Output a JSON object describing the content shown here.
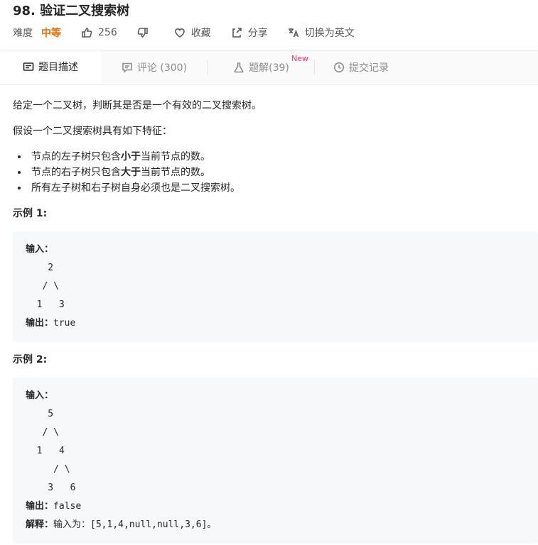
{
  "header": {
    "title": "98. 验证二叉搜索树",
    "difficulty_label": "难度",
    "difficulty": "中等",
    "likes": "256",
    "favorite_label": "收藏",
    "share_label": "分享",
    "lang_label": "切换为英文"
  },
  "tabs": [
    {
      "label": "题目描述"
    },
    {
      "label": "评论 (300)"
    },
    {
      "label": "题解(39)",
      "badge": "New"
    },
    {
      "label": "提交记录"
    }
  ],
  "problem": {
    "intro": "给定一个二叉树，判断其是否是一个有效的二叉搜索树。",
    "assume": "假设一个二叉搜索树具有如下特征：",
    "bullets": [
      {
        "pre": "节点的左子树只包含",
        "bold": "小于",
        "post": "当前节点的数。"
      },
      {
        "pre": "节点的右子树只包含",
        "bold": "大于",
        "post": "当前节点的数。"
      },
      {
        "pre": "所有左子树和右子树自身必须也是二叉搜索树。",
        "bold": "",
        "post": ""
      }
    ],
    "example1_title": "示例 1:",
    "example1": {
      "input_label": "输入：",
      "tree": [
        "    2",
        "   / \\",
        "  1   3"
      ],
      "output_label": "输出：",
      "output": "true"
    },
    "example2_title": "示例 2:",
    "example2": {
      "input_label": "输入：",
      "tree": [
        "    5",
        "   / \\",
        "  1   4",
        "     / \\",
        "    3   6"
      ],
      "output_label": "输出：",
      "output": "false",
      "explain_label": "解释：",
      "explain_pre": "输入为：",
      "explain_code": "[5,1,4,null,null,3,6]",
      "explain_post": "。"
    }
  },
  "colors": {
    "accent_difficulty": "#ef6c00",
    "new_badge": "#f5357e",
    "code_bg": "#f7f8fa"
  }
}
